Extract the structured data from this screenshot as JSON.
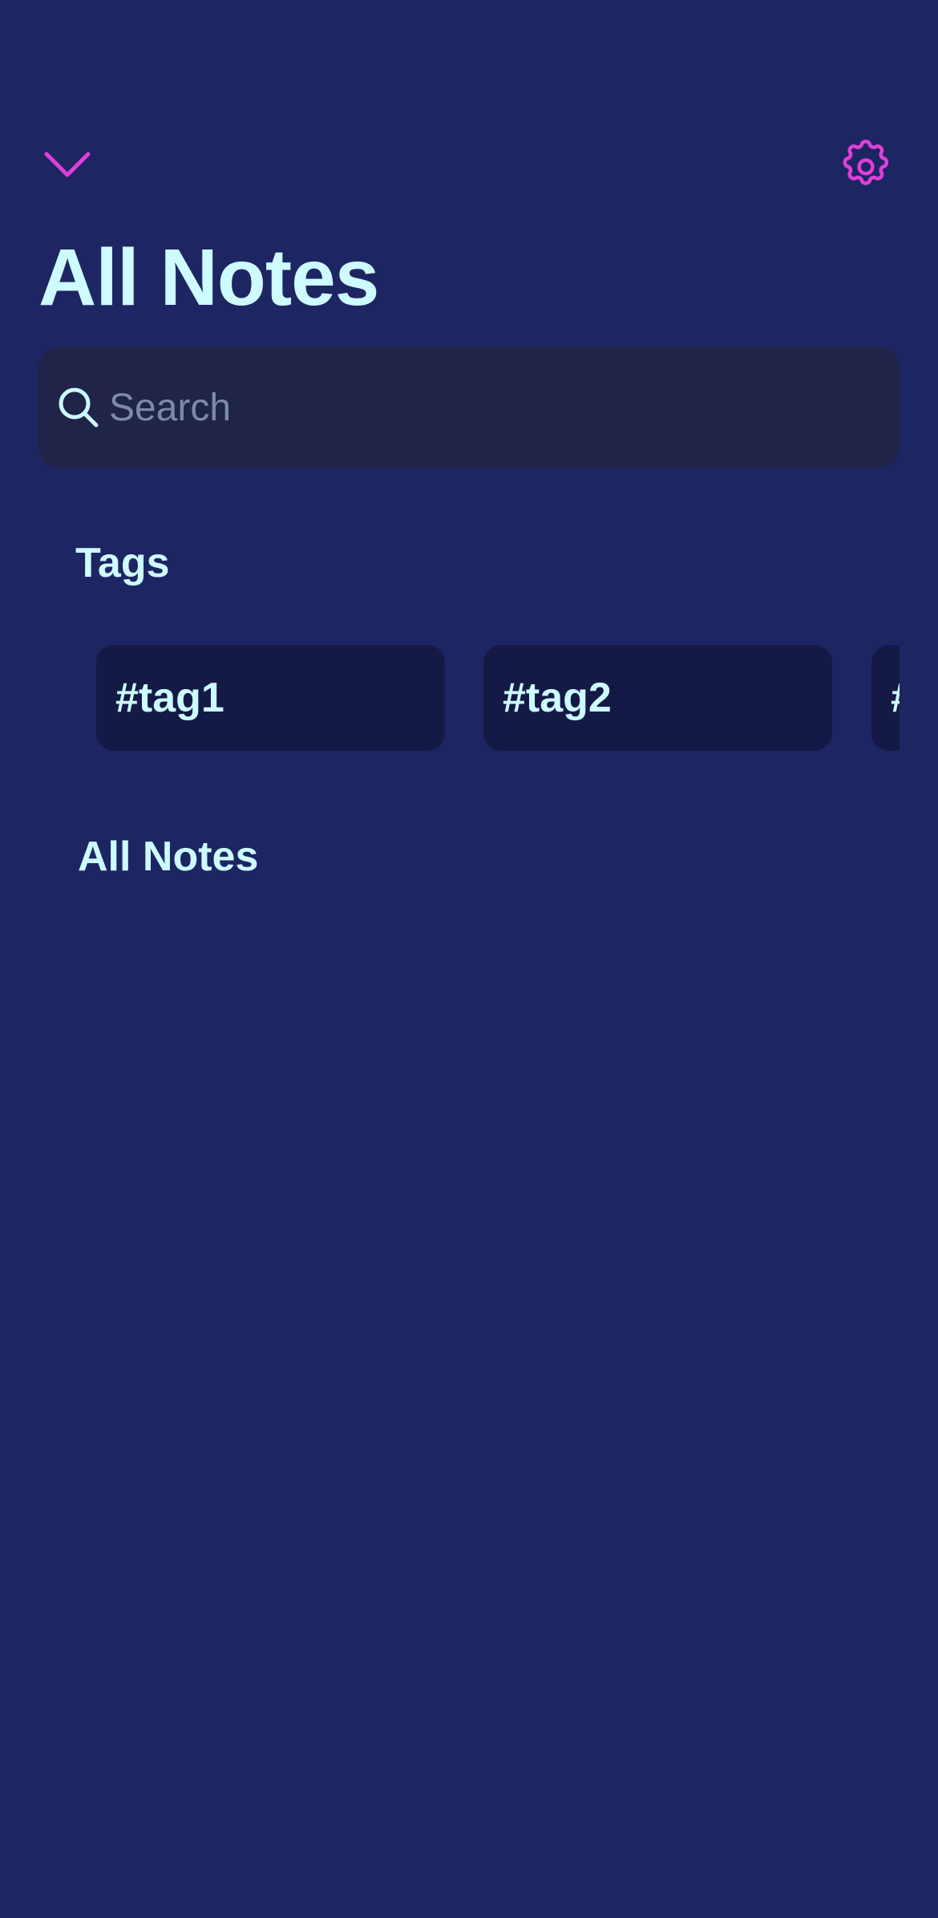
{
  "header": {
    "collapse_icon": "chevron-down-icon",
    "settings_icon": "gear-icon",
    "accent_color": "#e03fd8"
  },
  "page": {
    "title": "All Notes"
  },
  "search": {
    "placeholder": "Search",
    "value": "",
    "icon": "search-icon"
  },
  "tags": {
    "heading": "Tags",
    "items": [
      {
        "label": "#tag1"
      },
      {
        "label": "#tag2"
      },
      {
        "label": "#"
      }
    ]
  },
  "notes": {
    "heading": "All Notes",
    "items": []
  },
  "colors": {
    "background": "#1e2563",
    "text": "#cdfbff",
    "search_bg": "#1f2448",
    "chip_bg": "#141a45",
    "placeholder": "#7d8aa8"
  }
}
